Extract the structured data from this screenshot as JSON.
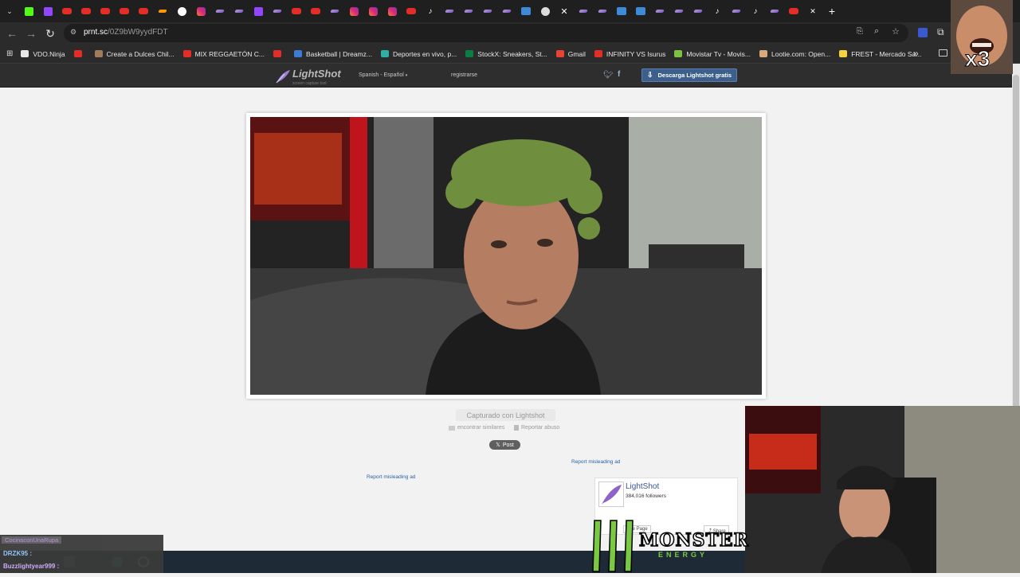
{
  "browser": {
    "tabs": [
      "kick",
      "twitch",
      "youtube",
      "youtube",
      "youtube",
      "youtube",
      "youtube",
      "fire",
      "spotify",
      "instagram",
      "pen",
      "pen",
      "twitch",
      "pen",
      "youtube",
      "youtube",
      "pen",
      "instagram",
      "instagram",
      "instagram",
      "youtube",
      "tiktok",
      "pen",
      "pen",
      "pen",
      "pen",
      "image",
      "github",
      "x",
      "pen",
      "pen",
      "image",
      "image",
      "pen",
      "pen",
      "pen",
      "tiktok",
      "pen",
      "tiktok",
      "pen",
      "youtube"
    ],
    "close_tab": "✕",
    "new_tab": "+",
    "url_host": "prnt.sc",
    "url_path": "/0Z9bW9yydFDT",
    "bookmarks": [
      {
        "label": "VDO.Ninja",
        "color": "#e8e8e8"
      },
      {
        "label": "",
        "color": "#e52d27"
      },
      {
        "label": "Create a Dulces Chil...",
        "color": "#a17c5b"
      },
      {
        "label": "MIX REGGAETÓN C...",
        "color": "#e52d27"
      },
      {
        "label": "",
        "color": "#e52d27"
      },
      {
        "label": "Basketball | Dreamz...",
        "color": "#3d7bd8"
      },
      {
        "label": "Deportes en vivo, p...",
        "color": "#2db1a5"
      },
      {
        "label": "StockX: Sneakers, St...",
        "color": "#0a7f3f"
      },
      {
        "label": "Gmail",
        "color": "#ea4335"
      },
      {
        "label": "INFINITY VS Isurus",
        "color": "#e52d27"
      },
      {
        "label": "Movistar Tv - Movis...",
        "color": "#7ec242"
      },
      {
        "label": "Lootie.com: Open...",
        "color": "#d9a97a"
      },
      {
        "label": "FREST - Mercado Sa...",
        "color": "#f7d33b"
      }
    ],
    "bookmarks_more": "»"
  },
  "lightshot": {
    "logo_name": "LightShot",
    "logo_sub": "screen capture tool",
    "language": "Spanish - Español",
    "register": "registrarse",
    "download_button": "Descarga Lightshot gratis",
    "caption": "Capturado con Lightshot",
    "find_similar": "encontrar similares",
    "report_abuse": "Reportar abuso",
    "post_button": "Post",
    "report_misleading_1": "Report misleading ad",
    "report_misleading_2": "Report misleading ad",
    "fb_page_name": "LightShot",
    "fb_followers": "384,016 followers",
    "fb_like": "Like Page",
    "fb_share": "Share"
  },
  "overlays": {
    "meme_text": "x3",
    "monster_text": "MONSTER",
    "monster_sub": "ENERGY",
    "chat_1": "CocinaconUnaRupa",
    "chat_2": "DRZK95 :",
    "chat_3": "Buzzlightyear999 :"
  },
  "colors": {
    "accent": "#3d5f8c",
    "brand_header": "#2e2e2e",
    "link": "#2a62a8"
  }
}
